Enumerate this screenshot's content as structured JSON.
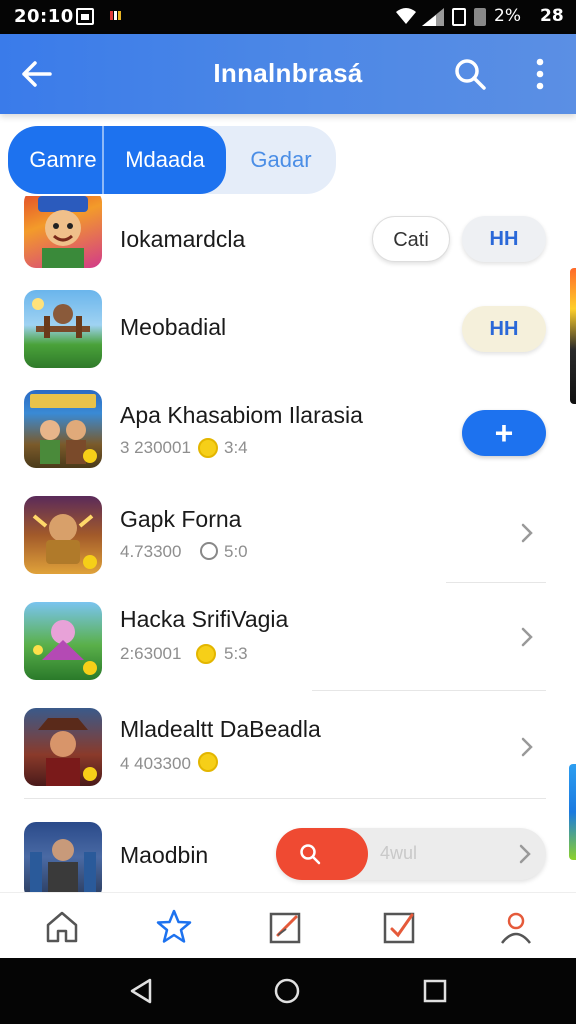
{
  "status_bar": {
    "time": "20:10",
    "battery_percent": "2%",
    "right_time": "28"
  },
  "app_bar": {
    "title": "Innalnbrasá",
    "icons": [
      "back-arrow-icon",
      "search-icon",
      "more-vert-icon"
    ]
  },
  "tabs": [
    {
      "label": "Gamre",
      "selected": true
    },
    {
      "label": "Mdaada",
      "selected": true
    },
    {
      "label": "Gadar",
      "selected": false
    }
  ],
  "items": [
    {
      "name": "Iokamardcla",
      "buttons": [
        "Cati",
        "HH"
      ]
    },
    {
      "name": "Meobadial",
      "buttons": [
        "HH"
      ]
    },
    {
      "name": "Apa Khasabiom Ilarasia",
      "meta": "3 230001",
      "rating": "3:4",
      "action": "+"
    },
    {
      "name": "Gapk Forna",
      "meta": "4.73300",
      "rating": "5:0"
    },
    {
      "name": "Hacka SrifiVagia",
      "meta": "2:63001",
      "rating": "5:3"
    },
    {
      "name": "Mladealtt DaBeadla",
      "meta": "4 403300"
    },
    {
      "name": "Maodbin",
      "search_placeholder": "4wul"
    }
  ],
  "colors": {
    "accent": "#1d72ef",
    "app_bar": "#4a86e6",
    "search_red": "#ef4a32",
    "coin": "#f6cf18"
  },
  "bottom_nav": [
    "home-icon",
    "star-icon",
    "edit-icon",
    "edit-check-icon",
    "profile-icon"
  ],
  "system_nav": [
    "back-triangle-icon",
    "home-circle-icon",
    "recents-square-icon"
  ]
}
